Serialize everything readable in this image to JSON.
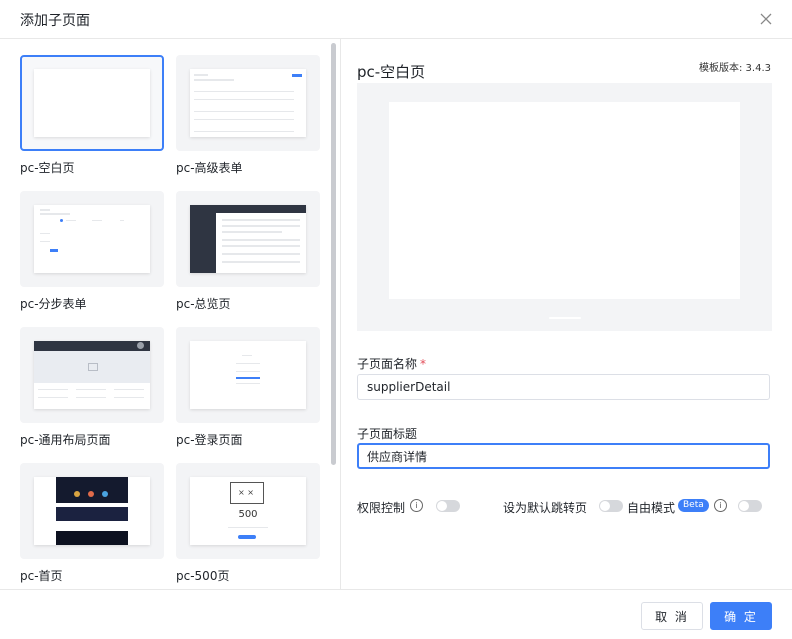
{
  "dialog": {
    "title": "添加子页面"
  },
  "templates": [
    {
      "label": "pc-空白页"
    },
    {
      "label": "pc-高级表单"
    },
    {
      "label": "pc-分步表单"
    },
    {
      "label": "pc-总览页"
    },
    {
      "label": "pc-通用布局页面"
    },
    {
      "label": "pc-登录页面"
    },
    {
      "label": "pc-首页"
    },
    {
      "label": "pc-500页"
    }
  ],
  "thumb_text": {
    "error_code": "500"
  },
  "preview": {
    "title": "pc-空白页",
    "version_label": "模板版本: 3.4.3"
  },
  "form": {
    "name_label": "子页面名称",
    "required_mark": "*",
    "name_value": "supplierDetail",
    "title_label": "子页面标题",
    "title_value": "供应商详情"
  },
  "switches": {
    "permission_label": "权限控制",
    "default_jump_label": "设为默认跳转页",
    "free_mode_label": "自由模式",
    "beta_label": "Beta",
    "info_glyph": "i"
  },
  "footer": {
    "cancel_label": "取 消",
    "ok_label": "确 定"
  },
  "colors": {
    "primary": "#3d7ff8",
    "required": "#e34d59",
    "border": "#e8e8e8",
    "preview_bg": "#f3f4f6"
  }
}
